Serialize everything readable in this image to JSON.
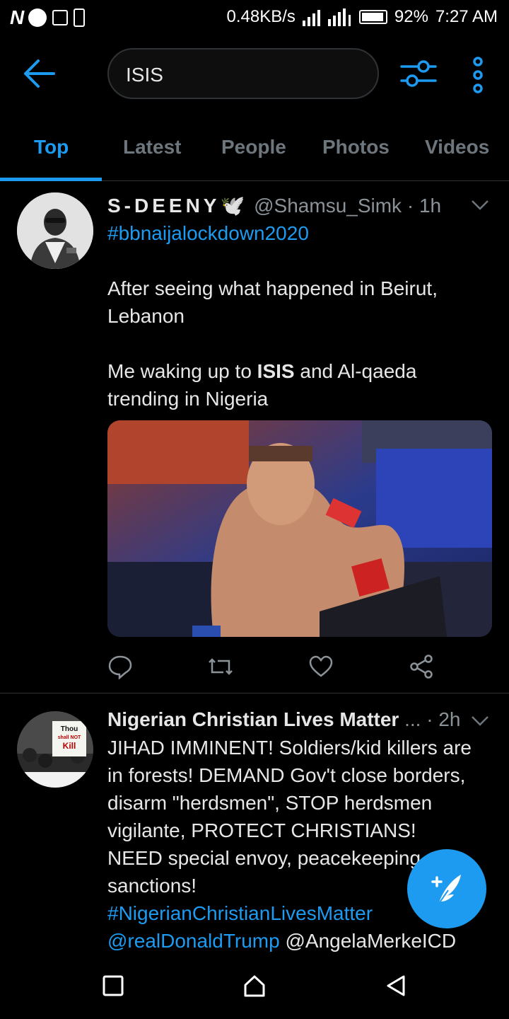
{
  "status_bar": {
    "left_icons": [
      "network-n-icon",
      "record-icon",
      "image-icon",
      "phone-alert-icon"
    ],
    "network_speed": "0.48KB/s",
    "battery_percent": "92%",
    "time": "7:27 AM"
  },
  "header": {
    "search_value": "ISIS",
    "icons": [
      "back-arrow-icon",
      "filter-icon",
      "more-vertical-icon"
    ]
  },
  "tabs": [
    {
      "label": "Top",
      "active": true
    },
    {
      "label": "Latest",
      "active": false
    },
    {
      "label": "People",
      "active": false
    },
    {
      "label": "Photos",
      "active": false
    },
    {
      "label": "Videos",
      "active": false
    }
  ],
  "tweets": [
    {
      "name": "S-DEENY🕊️",
      "handle": "@Shamsu_Simk",
      "time": "· 1h",
      "hashtag": "#bbnaijalockdown2020",
      "line1": "After seeing what happened in Beirut, Lebanon",
      "line2_pre": "Me waking up to ",
      "line2_bold": "ISIS",
      "line2_post": " and Al-qaeda trending in Nigeria",
      "has_media": true
    },
    {
      "name": "Nigerian Christian Lives Matter",
      "handle": "...",
      "time": "· 2h",
      "text": "JIHAD IMMINENT!  Soldiers/kid killers are in forests!  DEMAND Gov't close borders, disarm \"herdsmen\", STOP herdsmen vigilante, PROTECT CHRISTIANS! NEED special envoy, peacekeeping, & sanctions!",
      "hashtag": "#NigerianChristianLivesMatter",
      "mention1": "@realDonaldTrump",
      "mention2": "@AngelaMerkeICD",
      "avatar_sign": [
        "Thou",
        "shall NOT",
        "Kill"
      ]
    }
  ],
  "fab": {
    "icon": "compose-tweet-icon"
  },
  "navbar": {
    "icons": [
      "recents-square-icon",
      "home-icon",
      "back-triangle-icon"
    ]
  },
  "colors": {
    "accent": "#1d9bf0",
    "background": "#000000",
    "muted": "#6e767d"
  }
}
